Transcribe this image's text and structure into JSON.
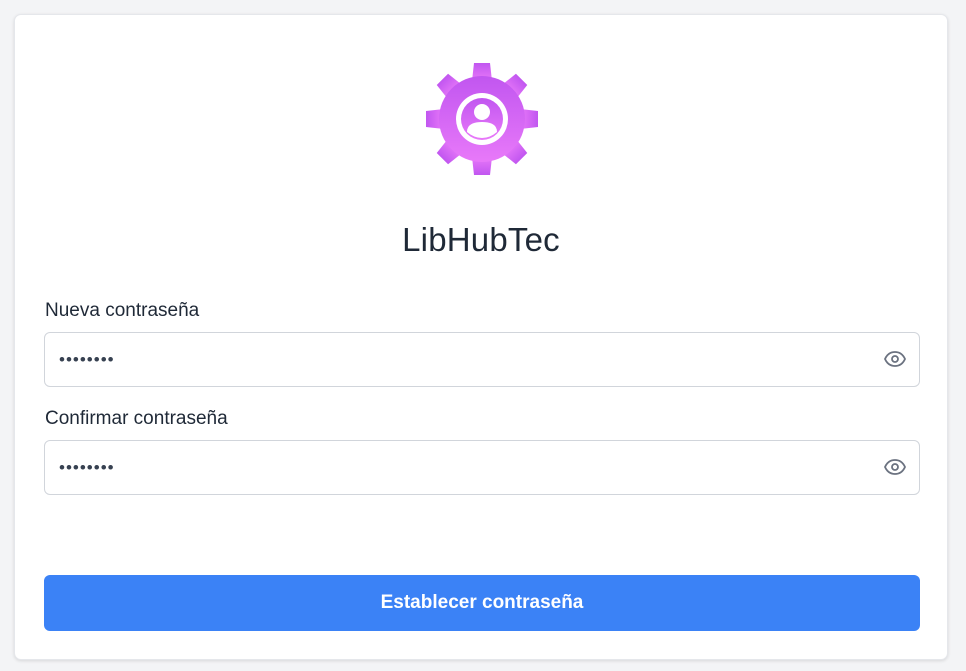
{
  "app": {
    "title": "LibHubTec",
    "logo_icon": "gear-user-icon",
    "logo_gradient": [
      "#c156f0",
      "#e879f9"
    ]
  },
  "form": {
    "new_password": {
      "label": "Nueva contraseña",
      "value": "••••••••",
      "toggle_icon": "eye-icon"
    },
    "confirm_password": {
      "label": "Confirmar contraseña",
      "value": "••••••••",
      "toggle_icon": "eye-icon"
    },
    "submit_label": "Establecer contraseña"
  },
  "colors": {
    "primary": "#3b82f6",
    "text": "#1f2937",
    "border": "#d1d5db"
  }
}
